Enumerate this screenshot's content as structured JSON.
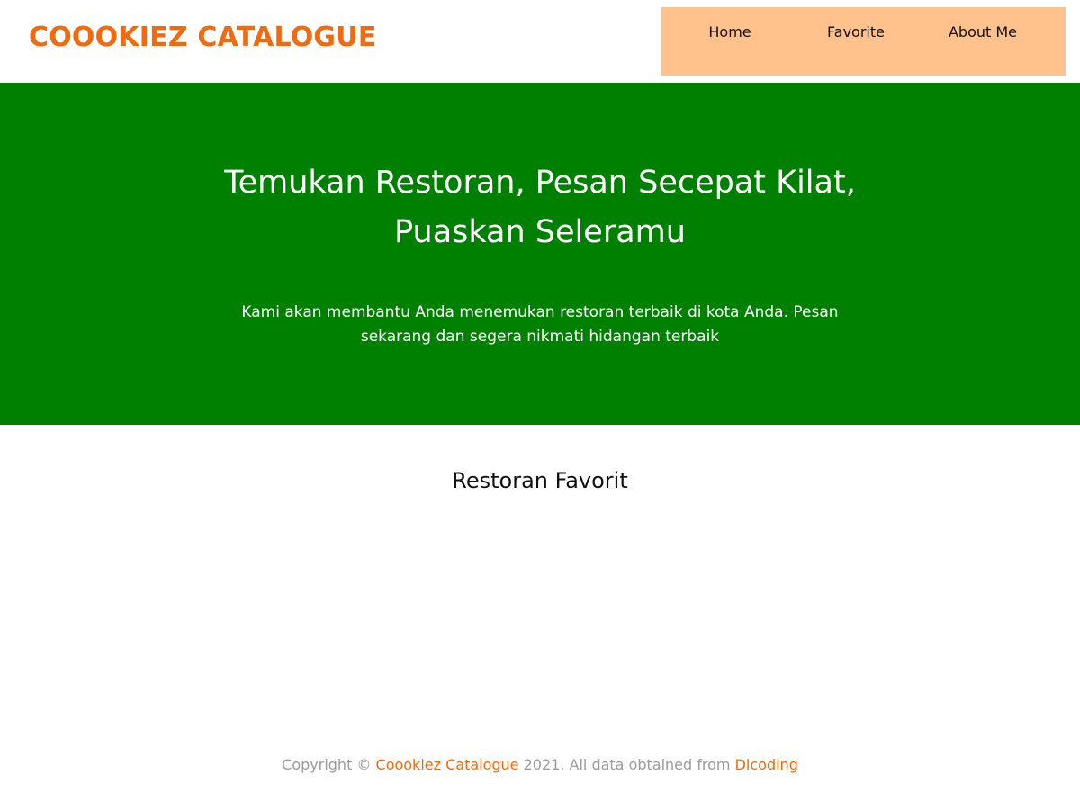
{
  "header": {
    "brand": "COOOKIEZ CATALOGUE",
    "nav": {
      "home": "Home",
      "favorite": "Favorite",
      "about": "About Me"
    }
  },
  "hero": {
    "title": "Temukan Restoran, Pesan Secepat Kilat, Puaskan Seleramu",
    "description": "Kami akan membantu Anda menemukan restoran terbaik di kota Anda. Pesan sekarang dan segera nikmati hidangan terbaik"
  },
  "main": {
    "section_title": "Restoran Favorit"
  },
  "footer": {
    "prefix": "Copyright ©",
    "brand_link": "Coookiez Catalogue",
    "middle": "2021. All data obtained from",
    "source_link": "Dicoding"
  },
  "colors": {
    "brand": "#f26a0f",
    "nav_bg": "#ffc28d",
    "hero_bg": "#008000"
  }
}
